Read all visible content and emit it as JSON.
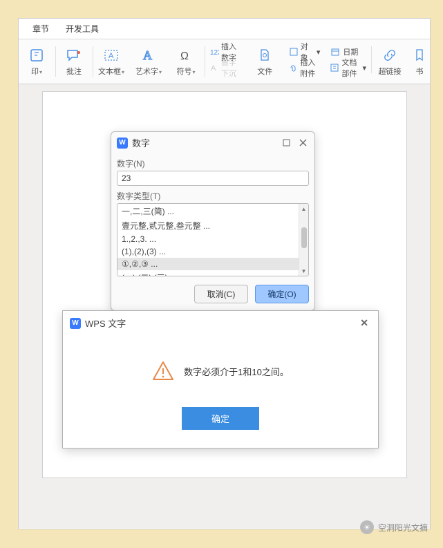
{
  "menu": {
    "chapter": "章节",
    "devtools": "开发工具"
  },
  "ribbon": {
    "stamp": "印",
    "annotate": "批注",
    "textbox": "文本框",
    "wordart": "艺术字",
    "symbol": "符号",
    "insertNumber": "插入数字",
    "file": "文件",
    "dropcap": "首字下沉",
    "object": "对象",
    "insertAttach": "插入附件",
    "date": "日期",
    "docParts": "文档部件",
    "hyperlink": "超链接",
    "bookmark": "书"
  },
  "dlg1": {
    "title": "数字",
    "numLabel": "数字(N)",
    "numValue": "23",
    "typeLabel": "数字类型(T)",
    "items": [
      "一,二,三(简) ...",
      "壹元整,贰元整,叁元整 ...",
      "1.,2.,3. ...",
      "(1),(2),(3) ...",
      "①,②,③ ...",
      "(一),(二),(三) ..."
    ],
    "cancel": "取消(C)",
    "ok": "确定(O)"
  },
  "dlg2": {
    "title": "WPS 文字",
    "message": "数字必须介于1和10之间。",
    "ok": "确定"
  },
  "watermark": "空洞阳光文摘"
}
